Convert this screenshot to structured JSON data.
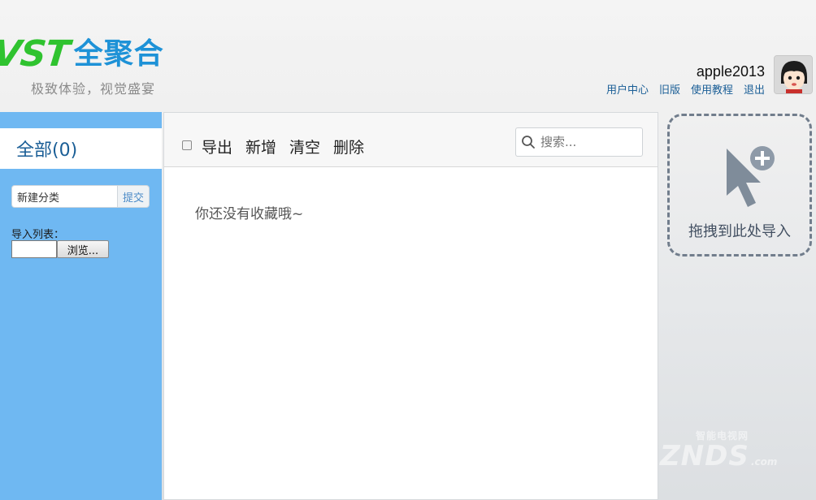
{
  "header": {
    "logo_latin": "VST",
    "logo_cn": "全聚合",
    "slogan": "极致体验，视觉盛宴",
    "username": "apple2013",
    "links": [
      "用户中心",
      "旧版",
      "使用教程",
      "退出"
    ]
  },
  "sidebar": {
    "tab_all": "全部(0)",
    "new_category": {
      "value": "新建分类",
      "submit": "提交"
    },
    "import_label": "导入列表：",
    "browse": "浏览..."
  },
  "toolbar": {
    "actions": [
      "导出",
      "新增",
      "清空",
      "删除"
    ],
    "search_placeholder": "搜索..."
  },
  "main": {
    "empty_message": "你还没有收藏哦~"
  },
  "dropzone": {
    "label": "拖拽到此处导入"
  },
  "watermark": {
    "small": "智能电视网",
    "big": "ZNDS",
    "suffix": ".com"
  },
  "colors": {
    "logo_green": "#2fc32f",
    "logo_blue": "#1e92d7",
    "sidebar": "#6fb8f2",
    "link": "#1a5e96"
  }
}
